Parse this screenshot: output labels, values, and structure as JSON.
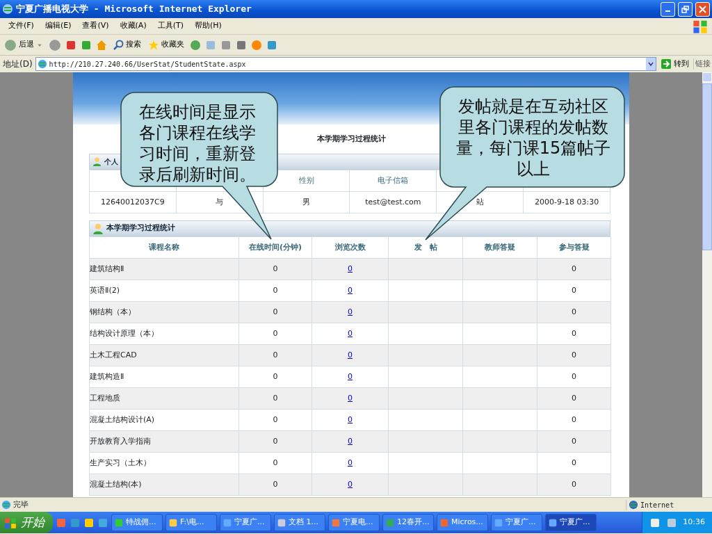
{
  "window": {
    "title": "宁夏广播电视大学 - Microsoft Internet Explorer"
  },
  "menu": [
    "文件(F)",
    "编辑(E)",
    "查看(V)",
    "收藏(A)",
    "工具(T)",
    "帮助(H)"
  ],
  "toolbar": {
    "back": "后退",
    "search": "搜索",
    "favorites": "收藏夹"
  },
  "address": {
    "label": "地址(D)",
    "url": "http://210.27.240.66/UserStat/StudentState.aspx",
    "go": "转到",
    "links": "链接"
  },
  "page": {
    "title": "本学期学习过程统计",
    "personal": {
      "title": "个人",
      "columns": [
        {
          "value": "12640012037C9"
        },
        {
          "value": "与"
        },
        {
          "header": "性别",
          "value": "男"
        },
        {
          "header": "电子信箱",
          "value": "test@test.com"
        },
        {
          "value": "站"
        },
        {
          "value": "2000-9-18 03:30"
        }
      ]
    },
    "study": {
      "title": "本学期学习过程统计",
      "columns": [
        "课程名称",
        "在线时间(分钟)",
        "浏览次数",
        "发　帖",
        "教师答疑",
        "参与答疑"
      ],
      "rows": [
        {
          "course": "建筑结构Ⅱ",
          "online": "0",
          "views": "0",
          "answers": "0"
        },
        {
          "course": "英语Ⅱ(2)",
          "online": "0",
          "views": "0",
          "answers": "0"
        },
        {
          "course": "钢结构（本）",
          "online": "0",
          "views": "0",
          "answers": "0"
        },
        {
          "course": "结构设计原理（本）",
          "online": "0",
          "views": "0",
          "answers": "0"
        },
        {
          "course": "土木工程CAD",
          "online": "0",
          "views": "0",
          "answers": "0"
        },
        {
          "course": "建筑构造Ⅱ",
          "online": "0",
          "views": "0",
          "answers": "0"
        },
        {
          "course": "工程地质",
          "online": "0",
          "views": "0",
          "answers": "0"
        },
        {
          "course": "混凝土结构设计(A)",
          "online": "0",
          "views": "0",
          "answers": "0"
        },
        {
          "course": "开放教育入学指南",
          "online": "0",
          "views": "0",
          "answers": "0"
        },
        {
          "course": "生产实习（土木）",
          "online": "0",
          "views": "0",
          "answers": "0"
        },
        {
          "course": "混凝土结构(本)",
          "online": "0",
          "views": "0",
          "answers": "0"
        }
      ]
    }
  },
  "callouts": [
    {
      "text": "在线时间是显示各门课程在线学习时间，重新登录后刷新时间。"
    },
    {
      "text": "发帖就是在互动社区里各门课程的发帖数量，每门课15篇帖子以上"
    }
  ],
  "status_bar": {
    "text": "完毕",
    "zone": "Internet"
  },
  "taskbar": {
    "start": "开始",
    "clock": "10:36",
    "tasks": [
      {
        "label": "特战佣...",
        "selected": false
      },
      {
        "label": "F:\\电...",
        "selected": false
      },
      {
        "label": "宁夏广...",
        "selected": false
      },
      {
        "label": "文档 1...",
        "selected": false
      },
      {
        "label": "宁夏电...",
        "selected": false
      },
      {
        "label": "12春开...",
        "selected": false
      },
      {
        "label": "Micros...",
        "selected": false
      },
      {
        "label": "宁夏广...",
        "selected": false
      },
      {
        "label": "宁夏广...",
        "selected": true
      }
    ]
  }
}
